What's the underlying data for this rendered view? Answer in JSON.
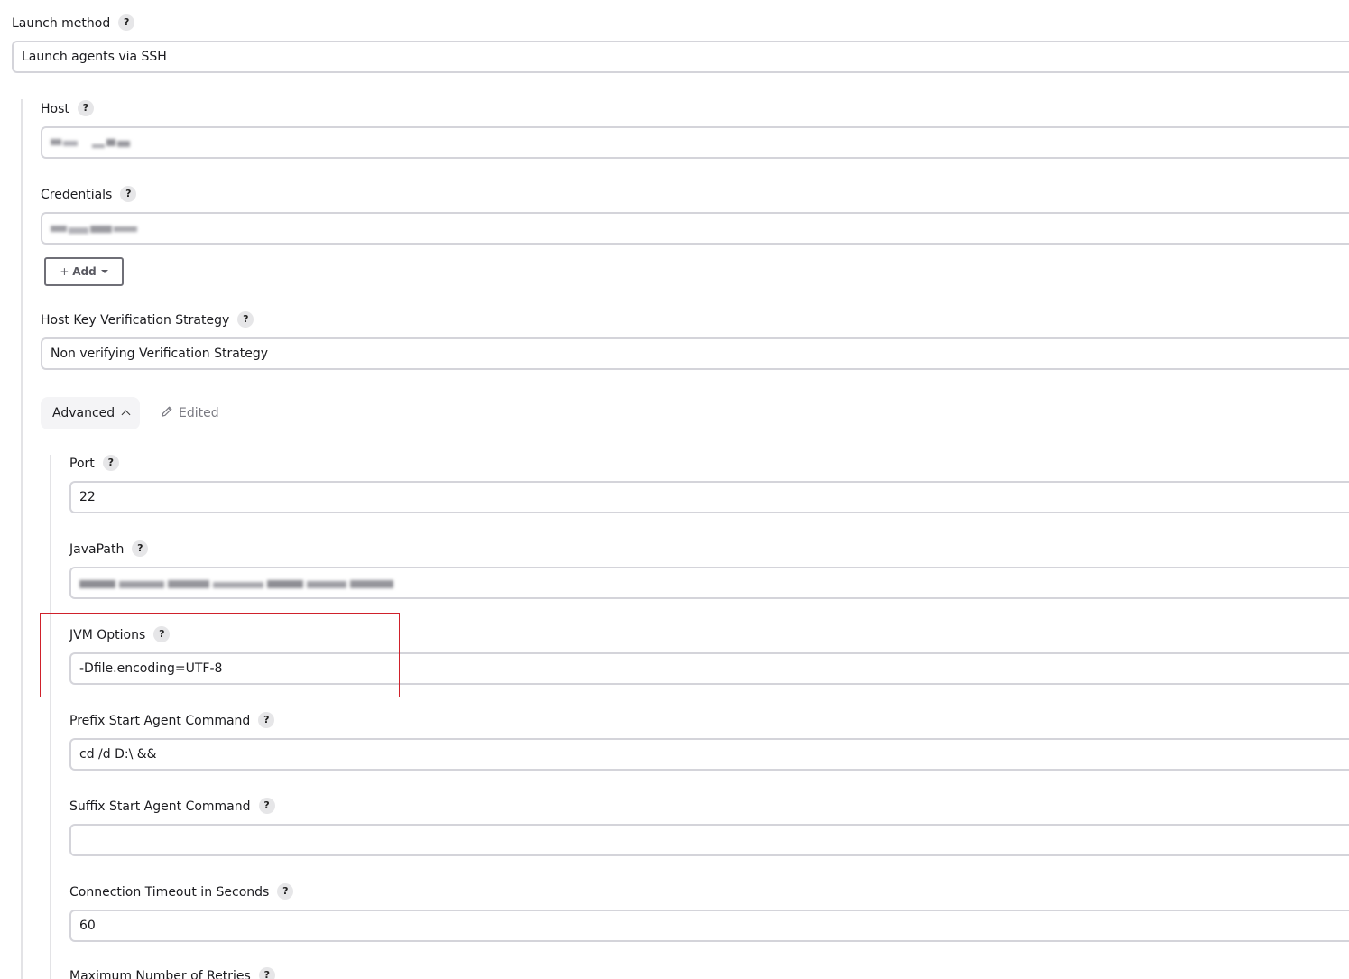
{
  "launch_method": {
    "label": "Launch method",
    "help": "?",
    "value": "Launch agents via SSH"
  },
  "host": {
    "label": "Host",
    "help": "?"
  },
  "credentials": {
    "label": "Credentials",
    "help": "?",
    "add_label": "Add",
    "add_prefix": "+"
  },
  "host_key": {
    "label": "Host Key Verification Strategy",
    "help": "?",
    "value": "Non verifying Verification Strategy"
  },
  "advanced": {
    "label": "Advanced",
    "edited": "Edited"
  },
  "port": {
    "label": "Port",
    "help": "?",
    "value": "22"
  },
  "java_path": {
    "label": "JavaPath",
    "help": "?"
  },
  "jvm_options": {
    "label": "JVM Options",
    "help": "?",
    "value": "-Dfile.encoding=UTF-8"
  },
  "prefix_cmd": {
    "label": "Prefix Start Agent Command",
    "help": "?",
    "value": "cd /d D:\\ &&"
  },
  "suffix_cmd": {
    "label": "Suffix Start Agent Command",
    "help": "?",
    "value": ""
  },
  "timeout": {
    "label": "Connection Timeout in Seconds",
    "help": "?",
    "value": "60"
  },
  "max_retries": {
    "label": "Maximum Number of Retries",
    "help": "?"
  },
  "colors": {
    "highlight": "#d0212b",
    "field_border": "#d4d4da",
    "help_bg": "#e6e6e8"
  }
}
